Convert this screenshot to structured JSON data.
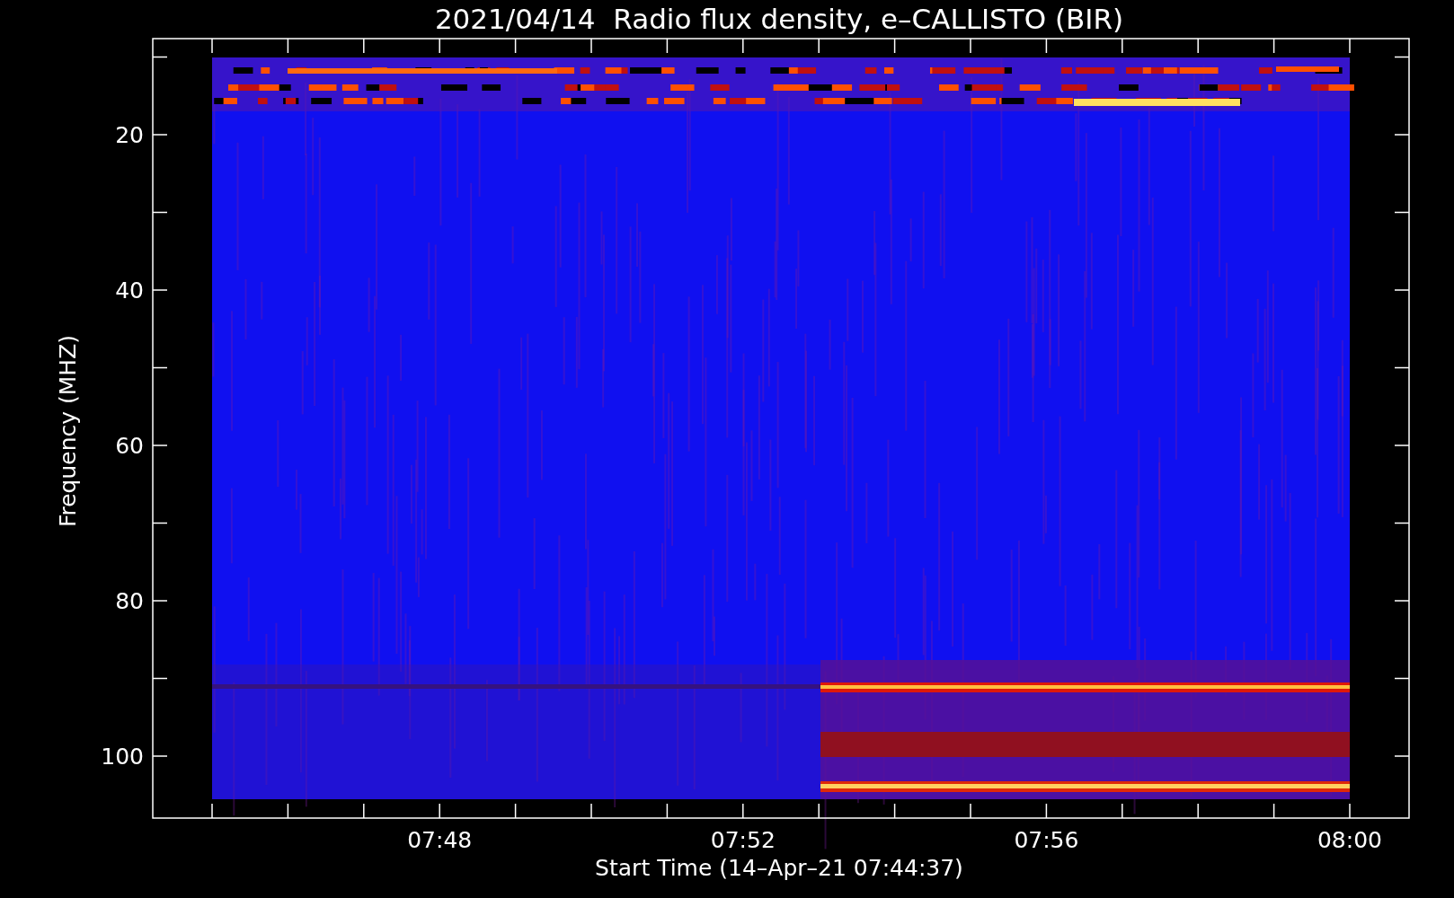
{
  "plot": {
    "title": "2021/04/14  Radio flux density, e–CALLISTO (BIR)",
    "ylabel": "Frequency (MHZ)",
    "xlabel": "Start Time (14–Apr–21 07:44:37)",
    "yticks": [
      "20",
      "40",
      "60",
      "80",
      "100"
    ],
    "xticks": [
      "07:48",
      "07:52",
      "07:56",
      "08:00"
    ]
  }
}
